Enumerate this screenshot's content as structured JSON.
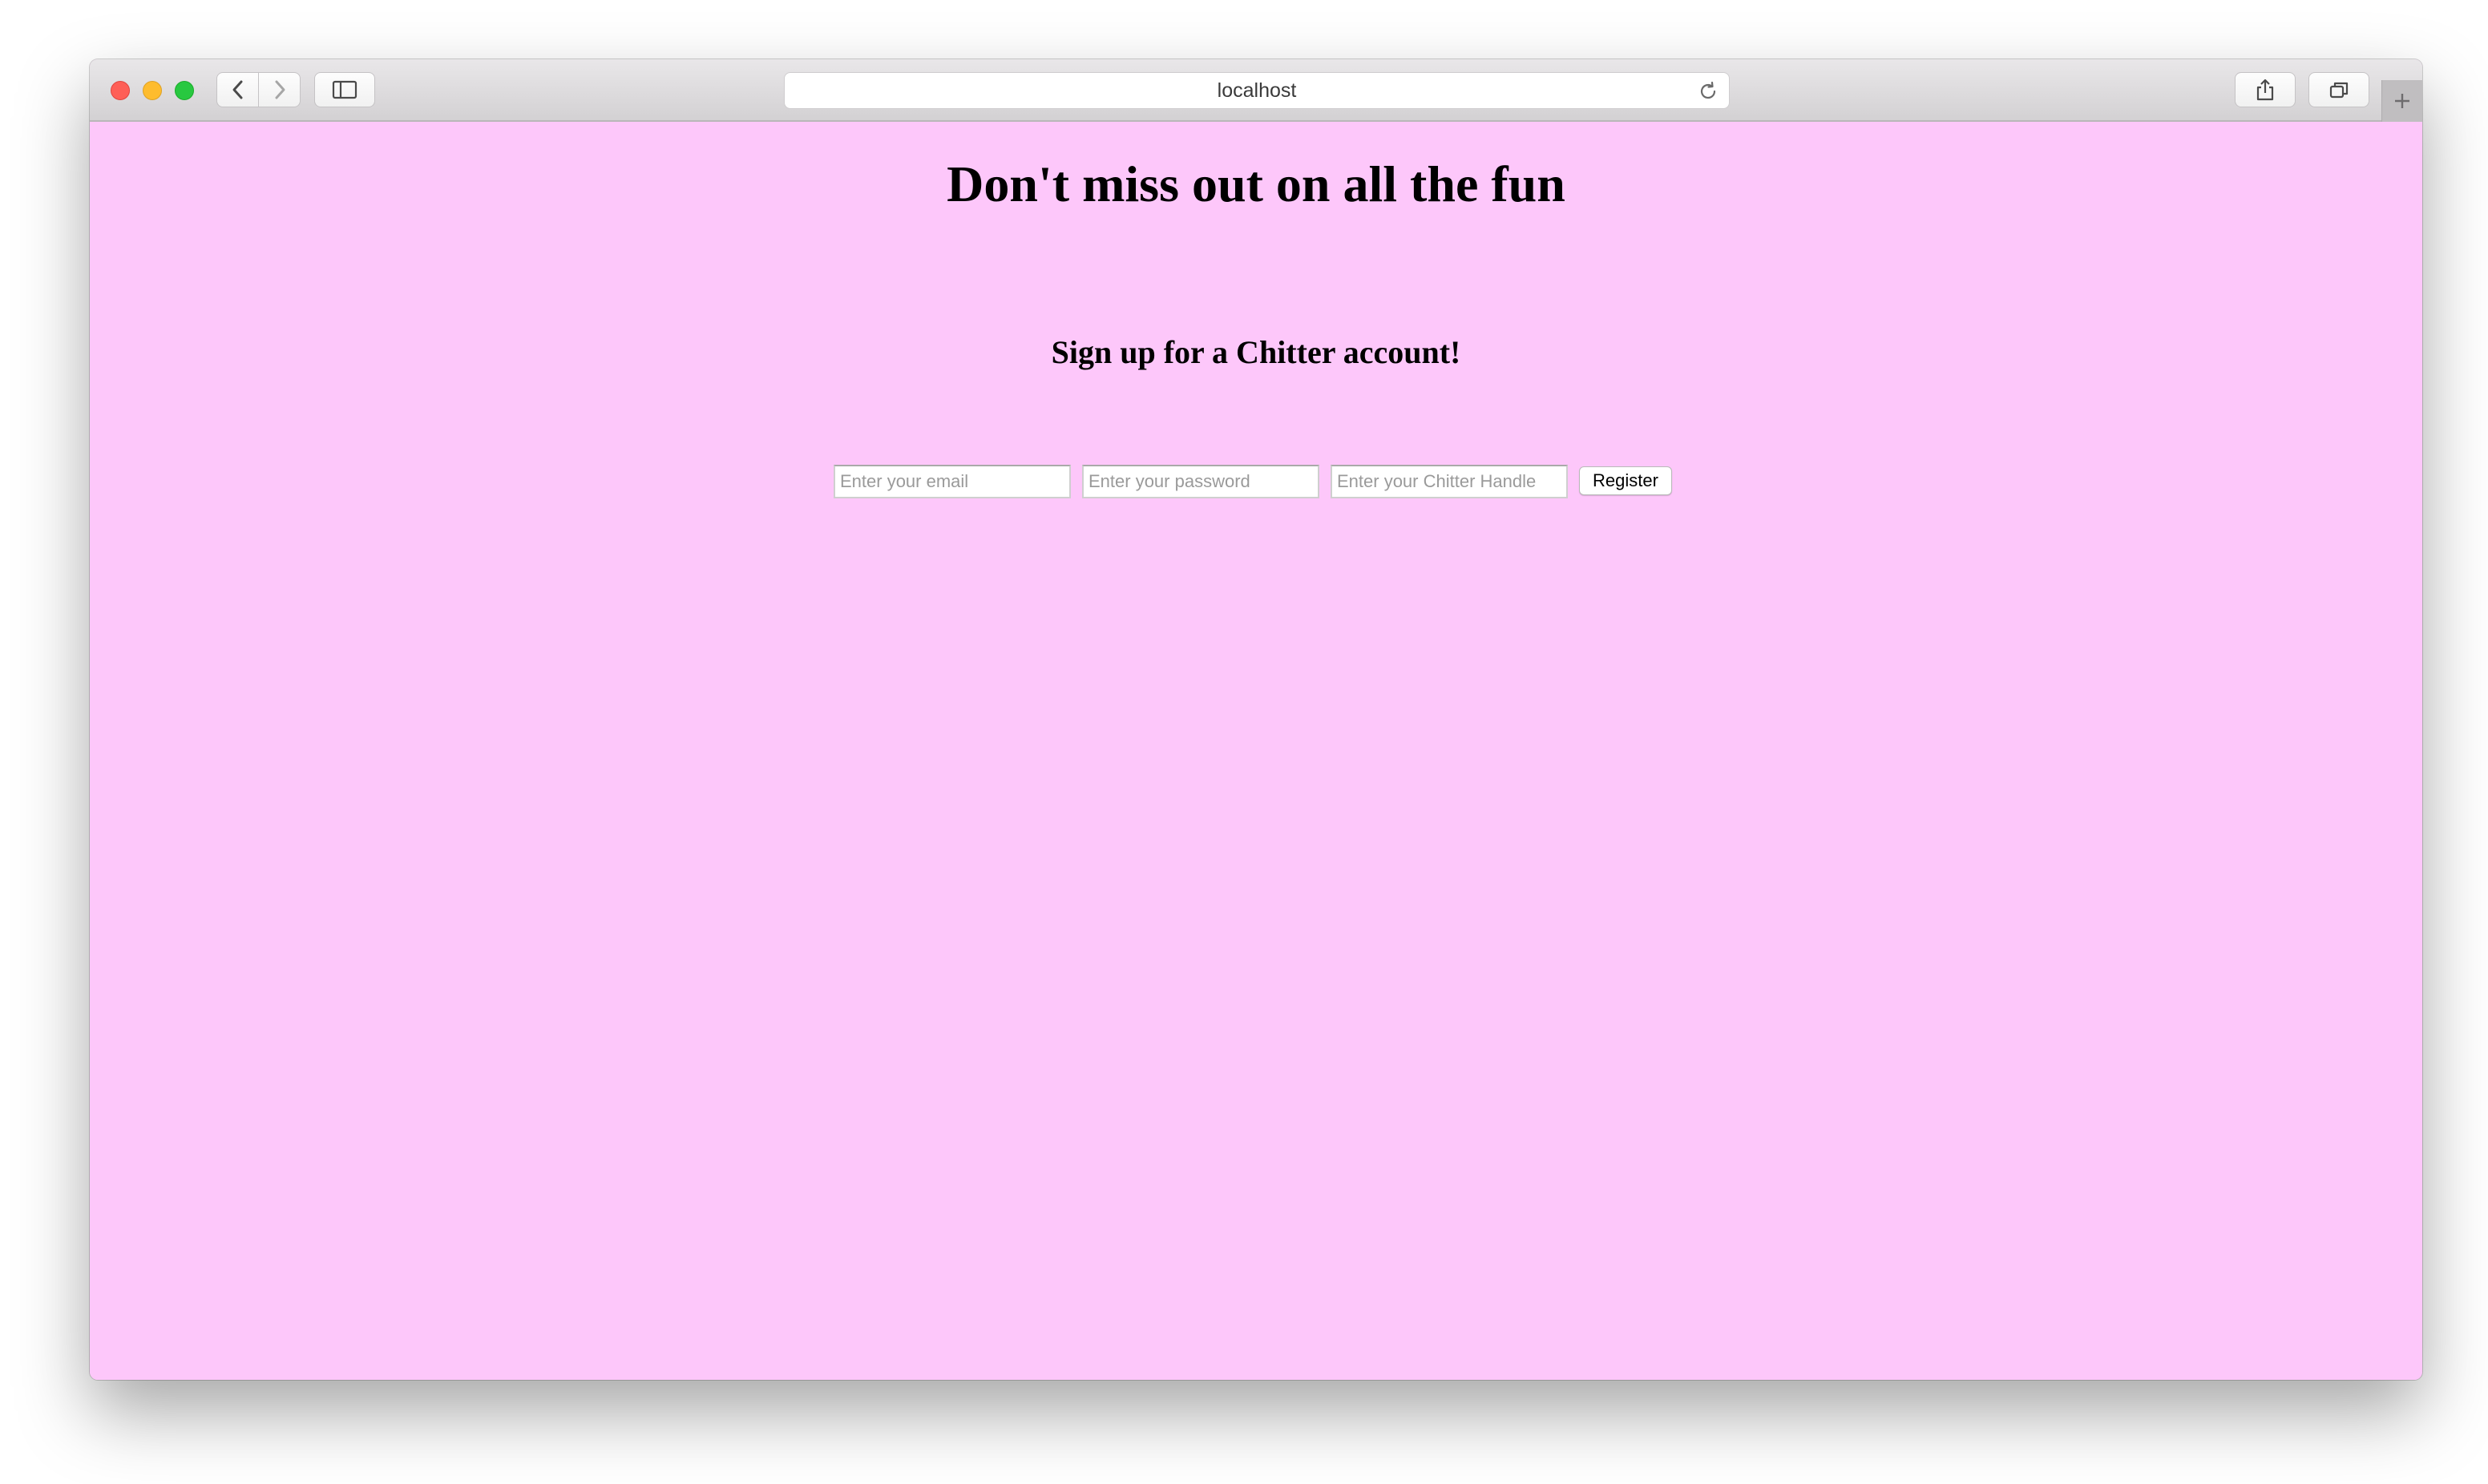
{
  "browser": {
    "address_bar": {
      "url": "localhost"
    },
    "icons": {
      "back": "chevron-left-icon",
      "forward": "chevron-right-icon",
      "sidebar": "sidebar-icon",
      "reload": "reload-icon",
      "share": "share-icon",
      "tabs": "tabs-overview-icon",
      "new_tab": "plus-icon"
    }
  },
  "page": {
    "background_color": "#fdc7fa",
    "headline": "Don't miss out on all the fun",
    "subheading": "Sign up for a Chitter account!",
    "form": {
      "email_placeholder": "Enter your email",
      "password_placeholder": "Enter your password",
      "handle_placeholder": "Enter your Chitter Handle",
      "register_label": "Register"
    }
  }
}
